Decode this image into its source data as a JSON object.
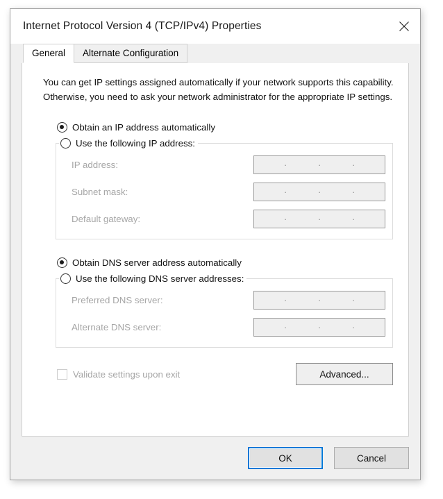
{
  "window": {
    "title": "Internet Protocol Version 4 (TCP/IPv4) Properties",
    "close_icon": "close-icon",
    "accent_color": "#0078d7"
  },
  "tabs": [
    {
      "label": "General",
      "active": true
    },
    {
      "label": "Alternate Configuration",
      "active": false
    }
  ],
  "general": {
    "description": "You can get IP settings assigned automatically if your network supports this capability. Otherwise, you need to ask your network administrator for the appropriate IP settings.",
    "ip_section": {
      "auto_option": "Obtain an IP address automatically",
      "auto_selected": true,
      "manual_option": "Use the following IP address:",
      "manual_selected": false,
      "fields": [
        {
          "label": "IP address:",
          "value": "",
          "enabled": false
        },
        {
          "label": "Subnet mask:",
          "value": "",
          "enabled": false
        },
        {
          "label": "Default gateway:",
          "value": "",
          "enabled": false
        }
      ]
    },
    "dns_section": {
      "auto_option": "Obtain DNS server address automatically",
      "auto_selected": true,
      "manual_option": "Use the following DNS server addresses:",
      "manual_selected": false,
      "fields": [
        {
          "label": "Preferred DNS server:",
          "value": "",
          "enabled": false
        },
        {
          "label": "Alternate DNS server:",
          "value": "",
          "enabled": false
        }
      ]
    },
    "validate_checkbox": {
      "label": "Validate settings upon exit",
      "checked": false,
      "enabled": false
    },
    "advanced_button": "Advanced..."
  },
  "footer": {
    "ok_label": "OK",
    "cancel_label": "Cancel"
  },
  "ip_separator": "."
}
